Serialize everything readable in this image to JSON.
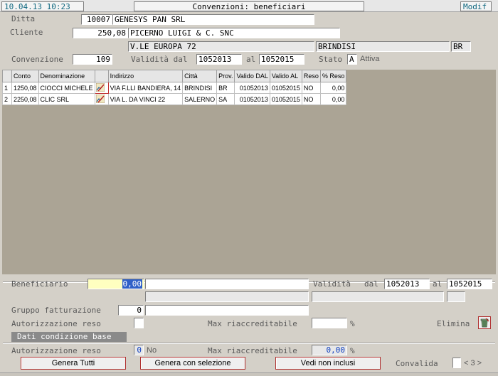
{
  "header": {
    "datetime": "10.04.13 10:23",
    "title": "Convenzioni: beneficiari",
    "mode": "Modif"
  },
  "top": {
    "ditta_label": "Ditta",
    "ditta_code": "10007",
    "ditta_name": "GENESYS PAN SRL",
    "cliente_label": "Cliente",
    "cliente_code": "250,08",
    "cliente_name": "PICERNO LUIGI & C. SNC",
    "address": "V.LE EUROPA 72",
    "city": "BRINDISI",
    "province": "BR",
    "convenzione_label": "Convenzione",
    "convenzione_value": "109",
    "validita_label": "Validità dal",
    "validita_dal": "1052013",
    "al_label": "al",
    "validita_al": "1052015",
    "stato_label": "Stato",
    "stato_value": "A",
    "stato_text": "Attiva"
  },
  "table": {
    "columns": [
      "",
      "Conto",
      "Denominazione",
      "",
      "Indirizzo",
      "Città",
      "Prov.",
      "Valido DAL",
      "Valido AL",
      "Reso",
      "% Reso"
    ],
    "rows": [
      {
        "n": "1",
        "conto": "1250,08",
        "denominazione": "CIOCCI MICHELE",
        "indirizzo": "VIA F.LLI BANDIERA, 14",
        "citta": "BRINDISI",
        "prov": "BR",
        "dal": "01052013",
        "al": "01052015",
        "reso": "NO",
        "perc": "0,00"
      },
      {
        "n": "2",
        "conto": "2250,08",
        "denominazione": "CLIC SRL",
        "indirizzo": "VIA L. DA VINCI 22",
        "citta": "SALERNO",
        "prov": "SA",
        "dal": "01052013",
        "al": "01052015",
        "reso": "NO",
        "perc": "0,00"
      }
    ]
  },
  "bottom": {
    "beneficiario_label": "Beneficiario",
    "beneficiario_value": "0,00",
    "validita_label": "Validità",
    "dal_label": "dal",
    "dal_value": "1052013",
    "al_label": "al",
    "al_value": "1052015",
    "gruppo_label": "Gruppo fatturazione",
    "gruppo_value": "0",
    "autorizzazione_label": "Autorizzazione reso",
    "max_label": "Max riaccreditabile",
    "percent_sign": "%",
    "elimina_label": "Elimina",
    "dati_label": "Dati condizione base",
    "base_autorizzazione_label": "Autorizzazione reso",
    "base_autorizzazione_value": "0",
    "base_autorizzazione_text": "No",
    "base_max_label": "Max riaccreditabile",
    "base_max_value": "0,00",
    "base_percent_sign": "%"
  },
  "buttons": {
    "genera_tutti": "Genera Tutti",
    "genera_selezione": "Genera con selezione",
    "vedi_non_inclusi": "Vedi non inclusi",
    "convalida_label": "Convalida",
    "pager": "< 3 >"
  },
  "icons": {
    "row_edit": "edit-pencil-icon",
    "elimina": "trash-icon"
  },
  "colors": {
    "grid_bg": "#aba495",
    "beneficiario_bg": "#ffffc0",
    "selected_value_bg": "#3060c8",
    "datetime_color": "#106880",
    "mode_color": "#106880",
    "base_value_color": "#1040c0"
  }
}
